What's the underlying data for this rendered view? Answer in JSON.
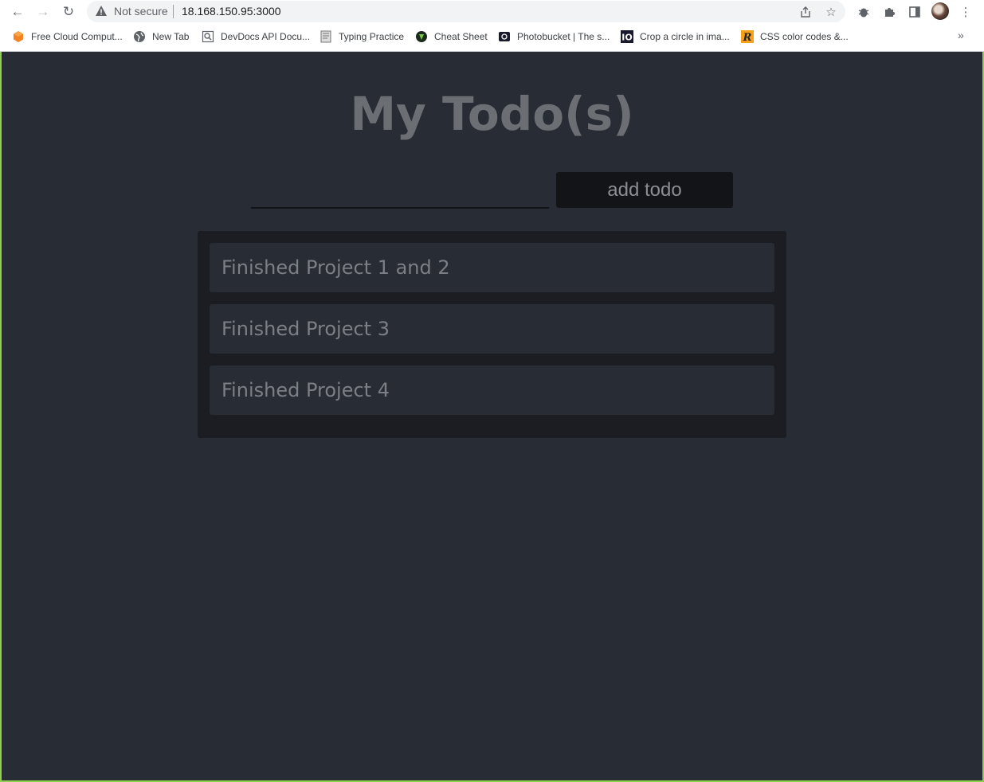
{
  "browser": {
    "security_label": "Not secure",
    "url": "18.168.150.95:3000",
    "bookmarks": [
      {
        "label": "Free Cloud Comput...",
        "icon": "aws-icon"
      },
      {
        "label": "New Tab",
        "icon": "globe-icon"
      },
      {
        "label": "DevDocs API Docu...",
        "icon": "devdocs-icon"
      },
      {
        "label": "Typing Practice",
        "icon": "typing-icon"
      },
      {
        "label": "Cheat Sheet",
        "icon": "cheatsheet-icon"
      },
      {
        "label": "Photobucket | The s...",
        "icon": "camera-icon"
      },
      {
        "label": "Crop a circle in ima...",
        "icon": "io-icon"
      },
      {
        "label": "CSS color codes &...",
        "icon": "r-icon"
      }
    ],
    "more_bookmarks": "»"
  },
  "page": {
    "title": "My Todo(s)",
    "input_value": "",
    "add_button_label": "add todo",
    "todos": [
      {
        "text": "Finished Project 1 and 2"
      },
      {
        "text": "Finished Project 3"
      },
      {
        "text": "Finished Project 4"
      }
    ]
  },
  "colors": {
    "page_background": "#282c34",
    "panel_background": "#1b1d22",
    "button_background": "#121417",
    "title_text": "#6b6e73",
    "item_text": "#7c7f85"
  }
}
